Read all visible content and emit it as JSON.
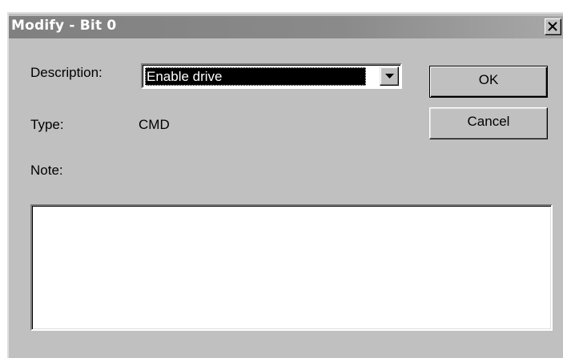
{
  "window": {
    "title": "Modify - Bit 0"
  },
  "form": {
    "description_label": "Description:",
    "description_value": "Enable drive",
    "type_label": "Type:",
    "type_value": "CMD",
    "note_label": "Note:",
    "note_value": ""
  },
  "buttons": {
    "ok_label": "OK",
    "cancel_label": "Cancel"
  },
  "icons": {
    "close": "close-icon",
    "dropdown": "dropdown-arrow-icon"
  },
  "colors": {
    "face": "#c0c0c0",
    "titlebar_inactive": "#808080",
    "selection": "#000000"
  }
}
